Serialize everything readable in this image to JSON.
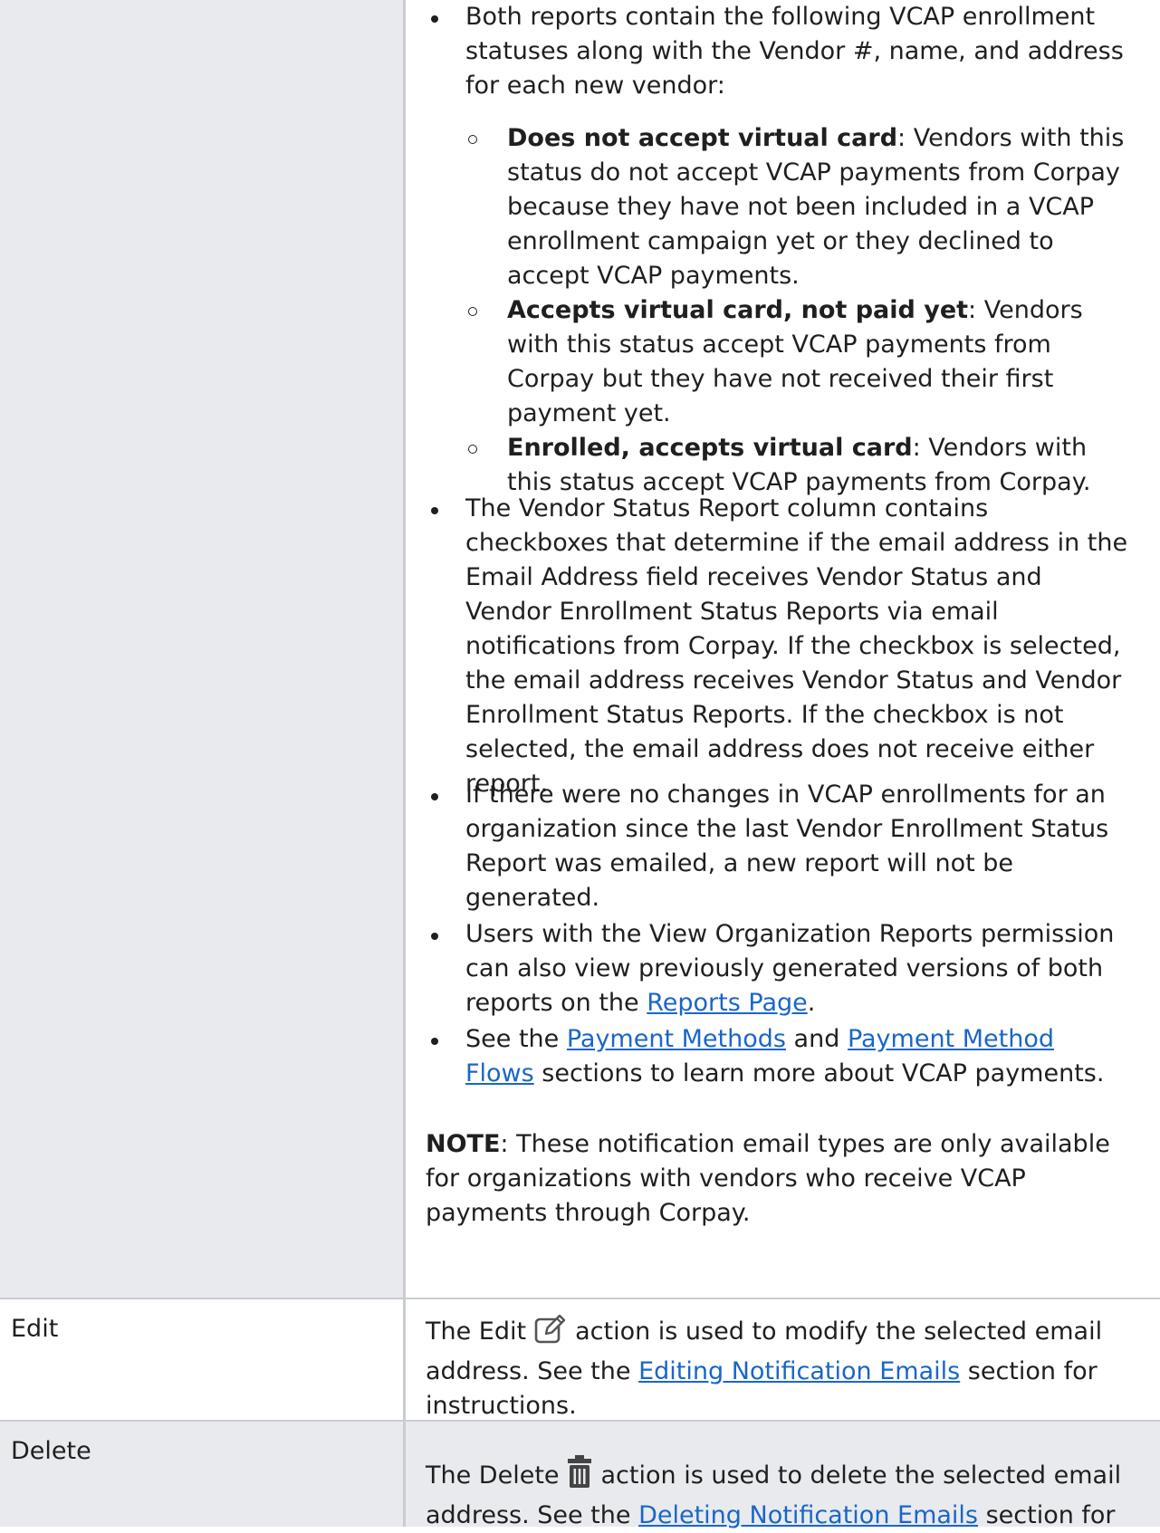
{
  "enrollment": {
    "intro": "Both reports contain the following VCAP enrollment statuses along with the Vendor #, name, and address for each new vendor:",
    "statuses": [
      {
        "term": "Does not accept virtual card",
        "desc": ": Vendors with this status do not accept VCAP payments from Corpay because they have not been included in a VCAP enrollment campaign yet or they declined to accept VCAP payments."
      },
      {
        "term": "Accepts virtual card, not paid yet",
        "desc": ": Vendors with this status accept VCAP payments from Corpay but they have not received their first payment yet."
      },
      {
        "term": "Enrolled, accepts virtual card",
        "desc": ": Vendors with this status accept VCAP payments from Corpay."
      }
    ]
  },
  "bullets": {
    "checkbox": "The Vendor Status Report column contains checkboxes that determine if the email address in the Email Address field receives Vendor Status and Vendor Enrollment Status Reports via email notifications from Corpay. If the checkbox is selected, the email address receives Vendor Status and Vendor Enrollment Status Reports. If the checkbox is not selected, the email address does not receive either report.",
    "no_changes": "If there were no changes in VCAP enrollments for an organization since the last Vendor Enrollment Status Report was emailed, a new report will not be generated.",
    "permission_pre": "Users with the View Organization Reports permission can also view previously generated versions of both reports on the ",
    "permission_link": "Reports Page",
    "permission_post": ".",
    "see_pre": "See the ",
    "see_link1": "Payment Methods",
    "see_mid": " and ",
    "see_link2": "Payment Method Flows",
    "see_post": " sections to learn more about VCAP payments."
  },
  "note": {
    "label": "NOTE",
    "text": ": These notification email types are only available for organizations with vendors who receive VCAP payments through Corpay."
  },
  "rows": {
    "edit": {
      "label": "Edit",
      "pre": "The Edit",
      "post": "action is used to modify the selected email address. See the ",
      "link": "Editing Notification Emails",
      "end": " section for instructions.",
      "icon": "edit-icon"
    },
    "delete": {
      "label": "Delete",
      "pre": "The Delete",
      "post": "action is used to delete the selected email address. See the ",
      "link": "Deleting Notification Emails",
      "end": " section for",
      "icon": "trash-icon"
    }
  }
}
